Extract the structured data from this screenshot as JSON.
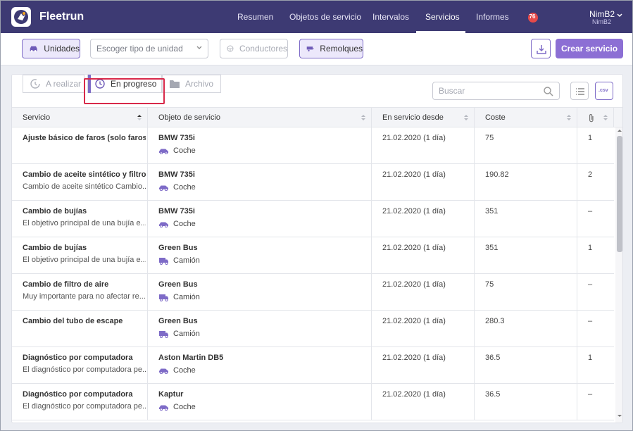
{
  "app": {
    "brand": "Fleetrun"
  },
  "nav": {
    "items": [
      {
        "label": "Resumen"
      },
      {
        "label": "Objetos de servicio"
      },
      {
        "label": "Intervalos"
      },
      {
        "label": "Servicios"
      },
      {
        "label": "Informes"
      }
    ],
    "active": "Servicios",
    "notifications": "76"
  },
  "user": {
    "name": "NimB2",
    "account": "NimB2"
  },
  "toolbar": {
    "unidades": "Unidades",
    "unit_type_placeholder": "Escoger tipo de unidad",
    "conductores": "Conductores",
    "remolques": "Remolques",
    "create": "Crear servicio"
  },
  "tabs": {
    "a_realizar": "A realizar",
    "en_progreso": "En progreso",
    "archivo": "Archivo"
  },
  "search": {
    "placeholder": "Buscar"
  },
  "export": {
    "csv_label": ".csv"
  },
  "table": {
    "columns": [
      {
        "label": "Servicio"
      },
      {
        "label": "Objeto de servicio"
      },
      {
        "label": "En servicio desde"
      },
      {
        "label": "Coste"
      },
      {
        "label": ""
      }
    ],
    "rows": [
      {
        "service": "Ajuste básico de faros (solo faros ...",
        "desc": "",
        "object": "BMW 735i",
        "type": "Coche",
        "since": "21.02.2020 (1 día)",
        "cost": "75",
        "files": "1"
      },
      {
        "service": "Cambio de aceite sintético y filtro",
        "desc": "Cambio de aceite sintético Cambio...",
        "object": "BMW 735i",
        "type": "Coche",
        "since": "21.02.2020 (1 día)",
        "cost": "190.82",
        "files": "2"
      },
      {
        "service": "Cambio de bujías",
        "desc": "El objetivo principal de una bujía e...",
        "object": "BMW 735i",
        "type": "Coche",
        "since": "21.02.2020 (1 día)",
        "cost": "351",
        "files": "–"
      },
      {
        "service": "Cambio de bujías",
        "desc": "El objetivo principal de una bujía e...",
        "object": "Green Bus",
        "type": "Camión",
        "since": "21.02.2020 (1 día)",
        "cost": "351",
        "files": "1"
      },
      {
        "service": "Cambio de filtro de aire",
        "desc": "Muy importante para no afectar re...",
        "object": "Green Bus",
        "type": "Camión",
        "since": "21.02.2020 (1 día)",
        "cost": "75",
        "files": "–"
      },
      {
        "service": "Cambio del tubo de escape",
        "desc": "",
        "object": "Green Bus",
        "type": "Camión",
        "since": "21.02.2020 (1 día)",
        "cost": "280.3",
        "files": "–"
      },
      {
        "service": "Diagnóstico por computadora",
        "desc": "El diagnóstico por computadora pe...",
        "object": "Aston Martin DB5",
        "type": "Coche",
        "since": "21.02.2020 (1 día)",
        "cost": "36.5",
        "files": "1"
      },
      {
        "service": "Diagnóstico por computadora",
        "desc": "El diagnóstico por computadora pe...",
        "object": "Kaptur",
        "type": "Coche",
        "since": "21.02.2020 (1 día)",
        "cost": "36.5",
        "files": "–"
      }
    ]
  },
  "colors": {
    "nav_bg": "#3d3a73",
    "accent": "#7e6bc7",
    "primary_button": "#8c6fd4",
    "highlight": "#d8294a",
    "notification": "#e64a4a"
  }
}
